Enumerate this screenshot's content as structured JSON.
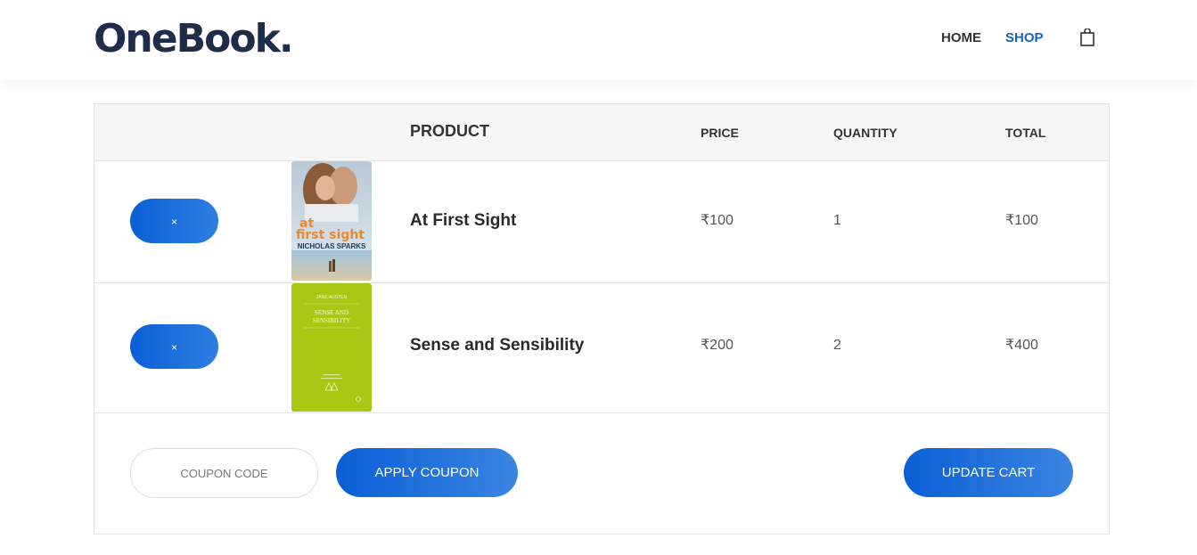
{
  "brand": {
    "logo": "OneBook."
  },
  "nav": {
    "home": "HOME",
    "shop": "SHOP",
    "cart_icon": "shopping-bag-icon"
  },
  "table": {
    "headers": {
      "product": "PRODUCT",
      "price": "PRICE",
      "quantity": "QUANTITY",
      "total": "TOTAL"
    },
    "rows": [
      {
        "remove_label": "×",
        "name": "At First Sight",
        "price": "₹100",
        "quantity": "1",
        "total": "₹100",
        "cover": {
          "title_line1": "at",
          "title_line2": "first sight",
          "author": "NICHOLAS SPARKS"
        }
      },
      {
        "remove_label": "×",
        "name": "Sense and Sensibility",
        "price": "₹200",
        "quantity": "2",
        "total": "₹400",
        "cover": {
          "author": "JANE AUSTEN",
          "title_line1": "SENSE AND",
          "title_line2": "SENSIBILITY"
        }
      }
    ]
  },
  "actions": {
    "coupon_placeholder": "COUPON CODE",
    "apply_coupon": "APPLY COUPON",
    "update_cart": "UPDATE CART"
  },
  "colors": {
    "accent": "#0a5fd6",
    "nav_active": "#1565c0",
    "logo": "#1e2d4a"
  }
}
